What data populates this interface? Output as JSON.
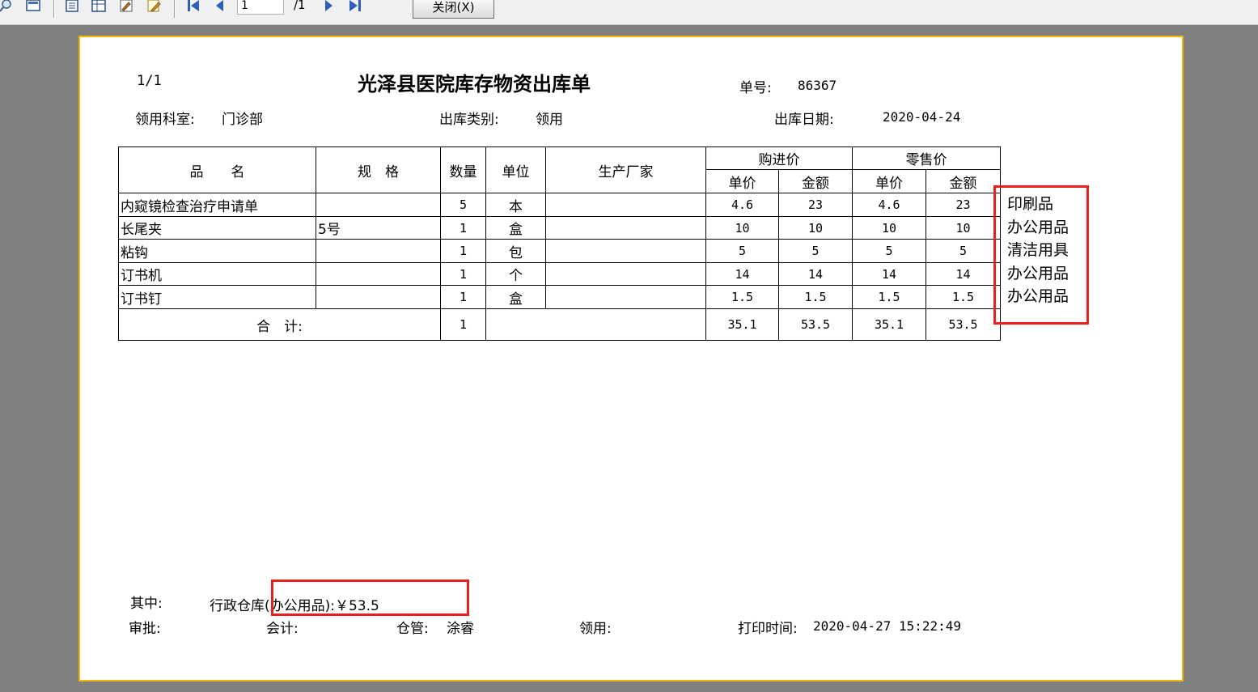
{
  "toolbar": {
    "page_current": "1",
    "page_total": "/1",
    "close_label": "关闭(X)"
  },
  "doc": {
    "page_no": "1/1",
    "title": "光泽县医院库存物资出库单",
    "order_label": "单号:",
    "order_value": "86367",
    "dept_label": "领用科室:",
    "dept_value": "门诊部",
    "type_label": "出库类别:",
    "type_value": "领用",
    "date_label": "出库日期:",
    "date_value": "2020-04-24"
  },
  "table": {
    "headers": {
      "name": "品　　名",
      "spec": "规　格",
      "qty": "数量",
      "unit": "单位",
      "maker": "生产厂家",
      "purchase": "购进价",
      "retail": "零售价",
      "price": "单价",
      "amount": "金额"
    },
    "rows": [
      {
        "name": "内窥镜检查治疗申请单",
        "spec": "",
        "qty": "5",
        "unit": "本",
        "maker": "",
        "p_price": "4.6",
        "p_amount": "23",
        "r_price": "4.6",
        "r_amount": "23",
        "category": "印刷品"
      },
      {
        "name": "长尾夹",
        "spec": "5号",
        "qty": "1",
        "unit": "盒",
        "maker": "",
        "p_price": "10",
        "p_amount": "10",
        "r_price": "10",
        "r_amount": "10",
        "category": "办公用品"
      },
      {
        "name": "粘钩",
        "spec": "",
        "qty": "1",
        "unit": "包",
        "maker": "",
        "p_price": "5",
        "p_amount": "5",
        "r_price": "5",
        "r_amount": "5",
        "category": "清洁用具"
      },
      {
        "name": "订书机",
        "spec": "",
        "qty": "1",
        "unit": "个",
        "maker": "",
        "p_price": "14",
        "p_amount": "14",
        "r_price": "14",
        "r_amount": "14",
        "category": "办公用品"
      },
      {
        "name": "订书钉",
        "spec": "",
        "qty": "1",
        "unit": "盒",
        "maker": "",
        "p_price": "1.5",
        "p_amount": "1.5",
        "r_price": "1.5",
        "r_amount": "1.5",
        "category": "办公用品"
      }
    ],
    "total": {
      "label": "合　计:",
      "qty": "1",
      "p_price": "35.1",
      "p_amount": "53.5",
      "r_price": "35.1",
      "r_amount": "53.5"
    }
  },
  "footer": {
    "among_label": "其中:",
    "among_value": "行政仓库(办公用品):￥53.5",
    "approve_label": "审批:",
    "account_label": "会计:",
    "keeper_label": "仓管:",
    "keeper_value": "涂睿",
    "receive_label": "领用:",
    "print_label": "打印时间:",
    "print_value": "2020-04-27 15:22:49"
  },
  "colors": {
    "paper_border": "#f5b400",
    "highlight": "#e8201e",
    "background": "#808080"
  },
  "icons": [
    "zoom-icon",
    "view-icon",
    "page-setup-icon",
    "layout-icon",
    "settings-icon",
    "edit-icon",
    "first-page-icon",
    "prev-page-icon",
    "next-page-icon",
    "last-page-icon"
  ]
}
